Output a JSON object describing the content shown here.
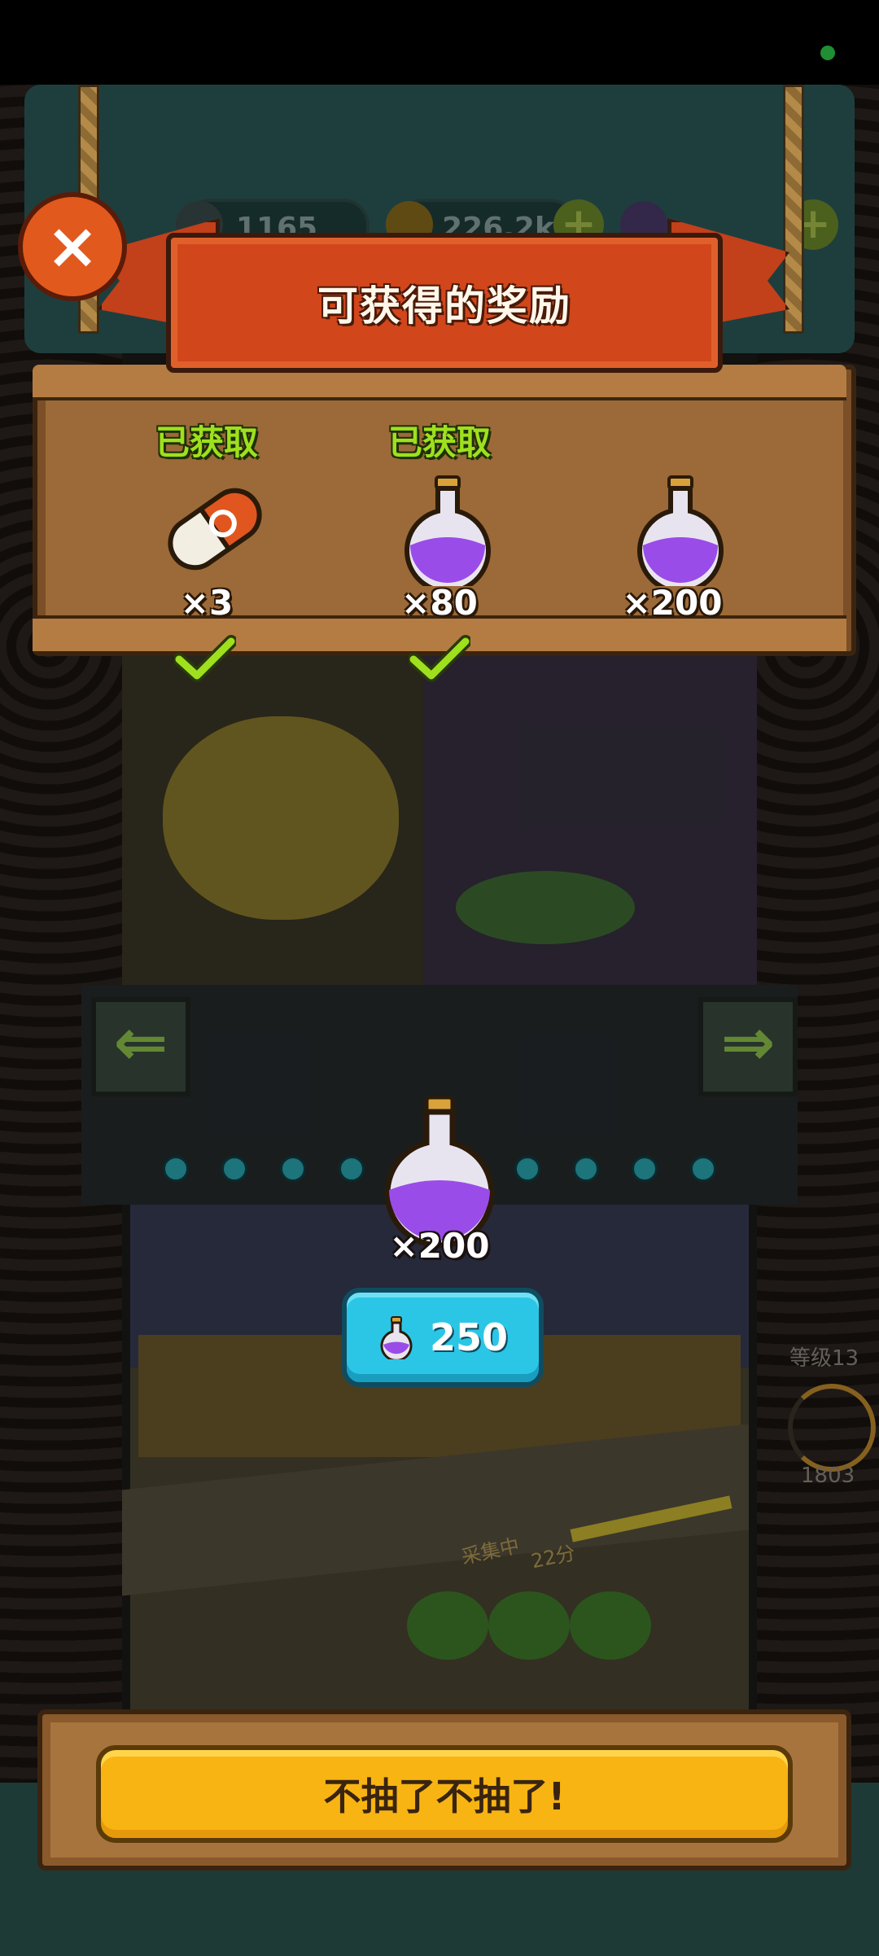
{
  "colors": {
    "status_dot": "#2ecc4a",
    "claimed_text": "#9ee01e",
    "banner_red": "#d2461c",
    "buy_button": "#2bc6e6",
    "stop_button": "#f8b412",
    "potion_purple": "#9a4ce8"
  },
  "resources": {
    "first_value": "1165",
    "coins_value": "226.2k"
  },
  "side_panel": {
    "level_label": "等级13",
    "count": "1803"
  },
  "gather": {
    "status_label": "采集中",
    "time_label": "22分"
  },
  "modal": {
    "title": "可获得的奖励",
    "close_icon": "×",
    "rewards": [
      {
        "status": "已获取",
        "quantity": "×3",
        "icon": "capsule-icon",
        "claimed": true
      },
      {
        "status": "已获取",
        "quantity": "×80",
        "icon": "potion-icon",
        "claimed": true
      },
      {
        "status": "",
        "quantity": "×200",
        "icon": "potion-icon",
        "claimed": false
      }
    ],
    "current_reward": {
      "quantity": "×200",
      "icon": "potion-icon"
    },
    "buy_button": {
      "price": "250",
      "icon": "potion-icon"
    },
    "stop_button_label": "不抽了不抽了!",
    "nav_arrows": {
      "left": "⇐",
      "right": "⇒"
    }
  }
}
